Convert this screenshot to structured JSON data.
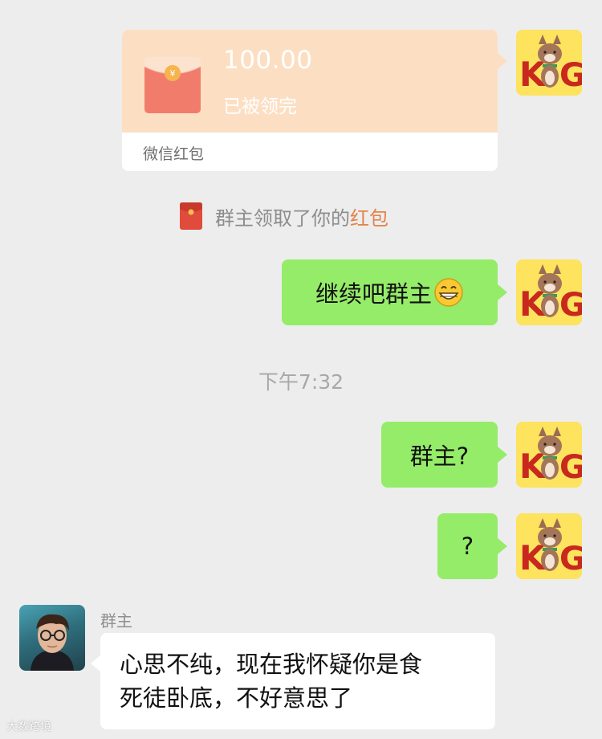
{
  "red_packet": {
    "amount": "100.00",
    "status": "已被领完",
    "label": "微信红包",
    "colors": {
      "top": "#fcdfc3",
      "envelope": "#f27c6c"
    }
  },
  "notice": {
    "prefix": "群主领取了你的",
    "link": "红包",
    "icon": "red-packet-icon"
  },
  "messages_sent": [
    {
      "text": "继续吧群主",
      "emoji": "grinning-face-icon"
    },
    {
      "text": "群主?"
    },
    {
      "text": "?"
    }
  ],
  "time": "下午7:32",
  "incoming": {
    "sender": "群主",
    "line1": "心思不纯，现在我怀疑你是食",
    "line2": "死徒卧底，不好意思了"
  },
  "avatars": {
    "self_text": "KING",
    "self_icon": "king-dog-avatar",
    "other_icon": "wizard-portrait-avatar"
  },
  "watermark": "大数跨境",
  "colors": {
    "background": "#ededed",
    "bubble_green": "#95ec69",
    "bubble_white": "#ffffff",
    "link_orange": "#e2844a"
  }
}
